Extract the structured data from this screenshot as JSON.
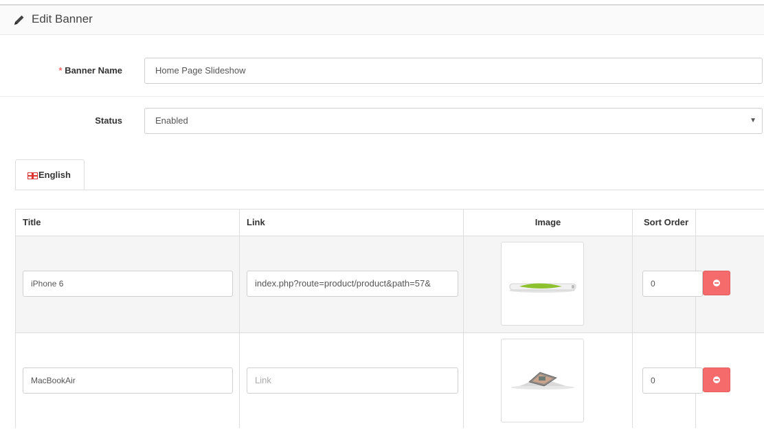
{
  "panel": {
    "title": "Edit Banner"
  },
  "form": {
    "banner_name_required_mark": "*",
    "banner_name_label": "Banner Name",
    "banner_name_value": "Home Page Slideshow",
    "status_label": "Status",
    "status_value": "Enabled"
  },
  "tabs": [
    {
      "label": "English",
      "icon": "uk-flag-icon"
    }
  ],
  "table": {
    "headers": {
      "title": "Title",
      "link": "Link",
      "image": "Image",
      "sort_order": "Sort Order"
    },
    "rows": [
      {
        "title": "iPhone 6",
        "link": "index.php?route=product/product&path=57&",
        "link_placeholder": "Link",
        "image_icon": "iphone-image",
        "sort_order": "0"
      },
      {
        "title": "MacBookAir",
        "link": "",
        "link_placeholder": "Link",
        "image_icon": "macbook-image",
        "sort_order": "0"
      }
    ]
  },
  "colors": {
    "danger": "#f56b6b",
    "required": "#f56b6b",
    "heading_bg": "#fafafa"
  }
}
